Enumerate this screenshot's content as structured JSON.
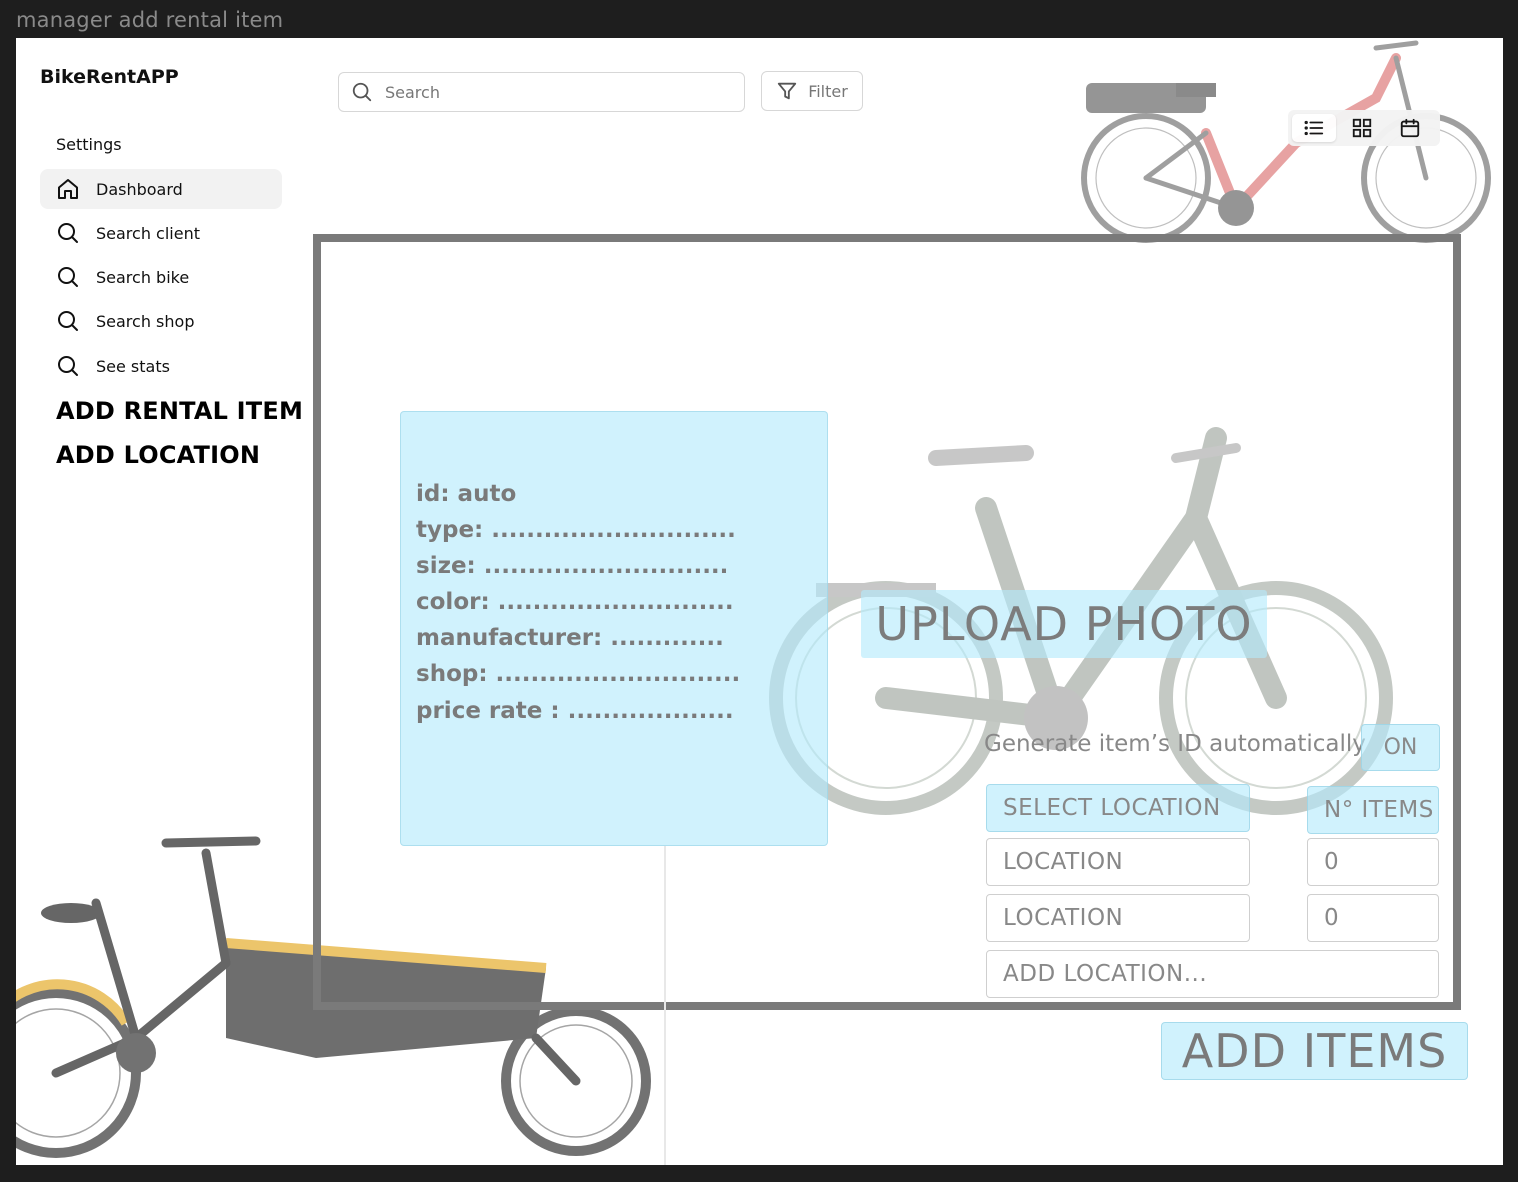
{
  "frame_label": "manager add rental item",
  "app_title": "BikeRentAPP",
  "sidebar": {
    "section_label": "Settings",
    "items": [
      {
        "label": "Dashboard",
        "icon": "home-icon"
      },
      {
        "label": "Search client",
        "icon": "search-icon"
      },
      {
        "label": "Search bike",
        "icon": "search-icon"
      },
      {
        "label": "Search shop",
        "icon": "search-icon"
      },
      {
        "label": "See stats",
        "icon": "search-icon"
      }
    ],
    "big_links": [
      "ADD RENTAL ITEM",
      "ADD LOCATION"
    ]
  },
  "topbar": {
    "search_placeholder": "Search",
    "filter_label": "Filter",
    "view_modes": [
      "list-icon",
      "grid-icon",
      "calendar-icon"
    ]
  },
  "form": {
    "fields": [
      "id: auto",
      "type: ............................",
      "size: ............................",
      "color: ...........................",
      "manufacturer: .............",
      "shop: ............................",
      "price rate : ..................."
    ],
    "upload_label": "UPLOAD PHOTO",
    "generate_id_label": "Generate item’s ID automatically",
    "generate_id_toggle": "ON",
    "select_location_label": "SELECT LOCATION",
    "n_items_label": "N° ITEMS",
    "locations": [
      {
        "location": "LOCATION",
        "count": "0"
      },
      {
        "location": "LOCATION",
        "count": "0"
      }
    ],
    "add_location_placeholder": "ADD LOCATION...",
    "submit_label": "ADD ITEMS"
  },
  "colors": {
    "accent_tint": "#b3eafc",
    "frame_border": "#7a7a7a",
    "background": "#1e1e1e"
  }
}
